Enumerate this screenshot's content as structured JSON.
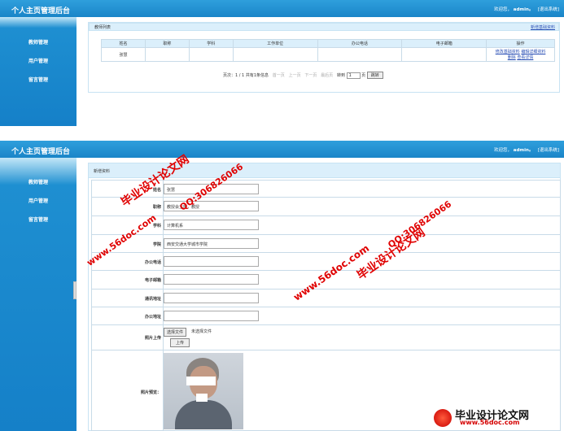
{
  "app": {
    "title": "个人主页管理后台",
    "welcome": "欢迎您，",
    "user": "admin。",
    "logout": "[退出系统]"
  },
  "sidebar": {
    "items": [
      {
        "label": "教师管理"
      },
      {
        "label": "用户管理"
      },
      {
        "label": "留言管理"
      }
    ]
  },
  "list_page": {
    "panel_title": "教师列表",
    "add_link": "新增基础资料",
    "columns": [
      "姓名",
      "职称",
      "学科",
      "工作单位",
      "办公电话",
      "电子邮箱",
      "操作"
    ],
    "rows": [
      {
        "name": "张慧",
        "title": "",
        "subject": "",
        "unit": "",
        "phone": "",
        "email": "",
        "ops": [
          "修改基础资料",
          "编辑详细资料",
          "删除",
          "查看详情"
        ]
      }
    ],
    "pager": {
      "info": "页次：1 / 1 共有1条信息",
      "first": "首一页",
      "prev": "上一页",
      "next": "下一页",
      "last": "最后页",
      "goto": "转到",
      "page_value": "1",
      "page_unit": "页",
      "jump": "跳转"
    }
  },
  "edit_page": {
    "panel_title": "新增资料",
    "fields": [
      {
        "label": "姓名",
        "value": "张慧"
      },
      {
        "label": "职称",
        "value": "教授会主席，教授"
      },
      {
        "label": "学科",
        "value": "计算机系"
      },
      {
        "label": "学院",
        "value": "西安交通大学城市学院"
      },
      {
        "label": "办公电话",
        "value": ""
      },
      {
        "label": "电子邮箱",
        "value": ""
      },
      {
        "label": "通讯地址",
        "value": ""
      },
      {
        "label": "办公地址",
        "value": ""
      }
    ],
    "upload": {
      "label": "照片上传",
      "choose": "选择文件",
      "nofile": "未选择文件",
      "submit": "上传"
    },
    "preview_label": "照片预览："
  },
  "watermarks": {
    "brand": "毕业设计论文网",
    "site": "www.56doc.com",
    "qq": "QQ:306826066",
    "site_short": "www.56doc.com"
  },
  "colors": {
    "topbar": "#1f8fd2",
    "sidebar": "#1580c8",
    "header_bg": "#dbeffb",
    "link": "#2a4fb5",
    "watermark": "#e00000"
  }
}
